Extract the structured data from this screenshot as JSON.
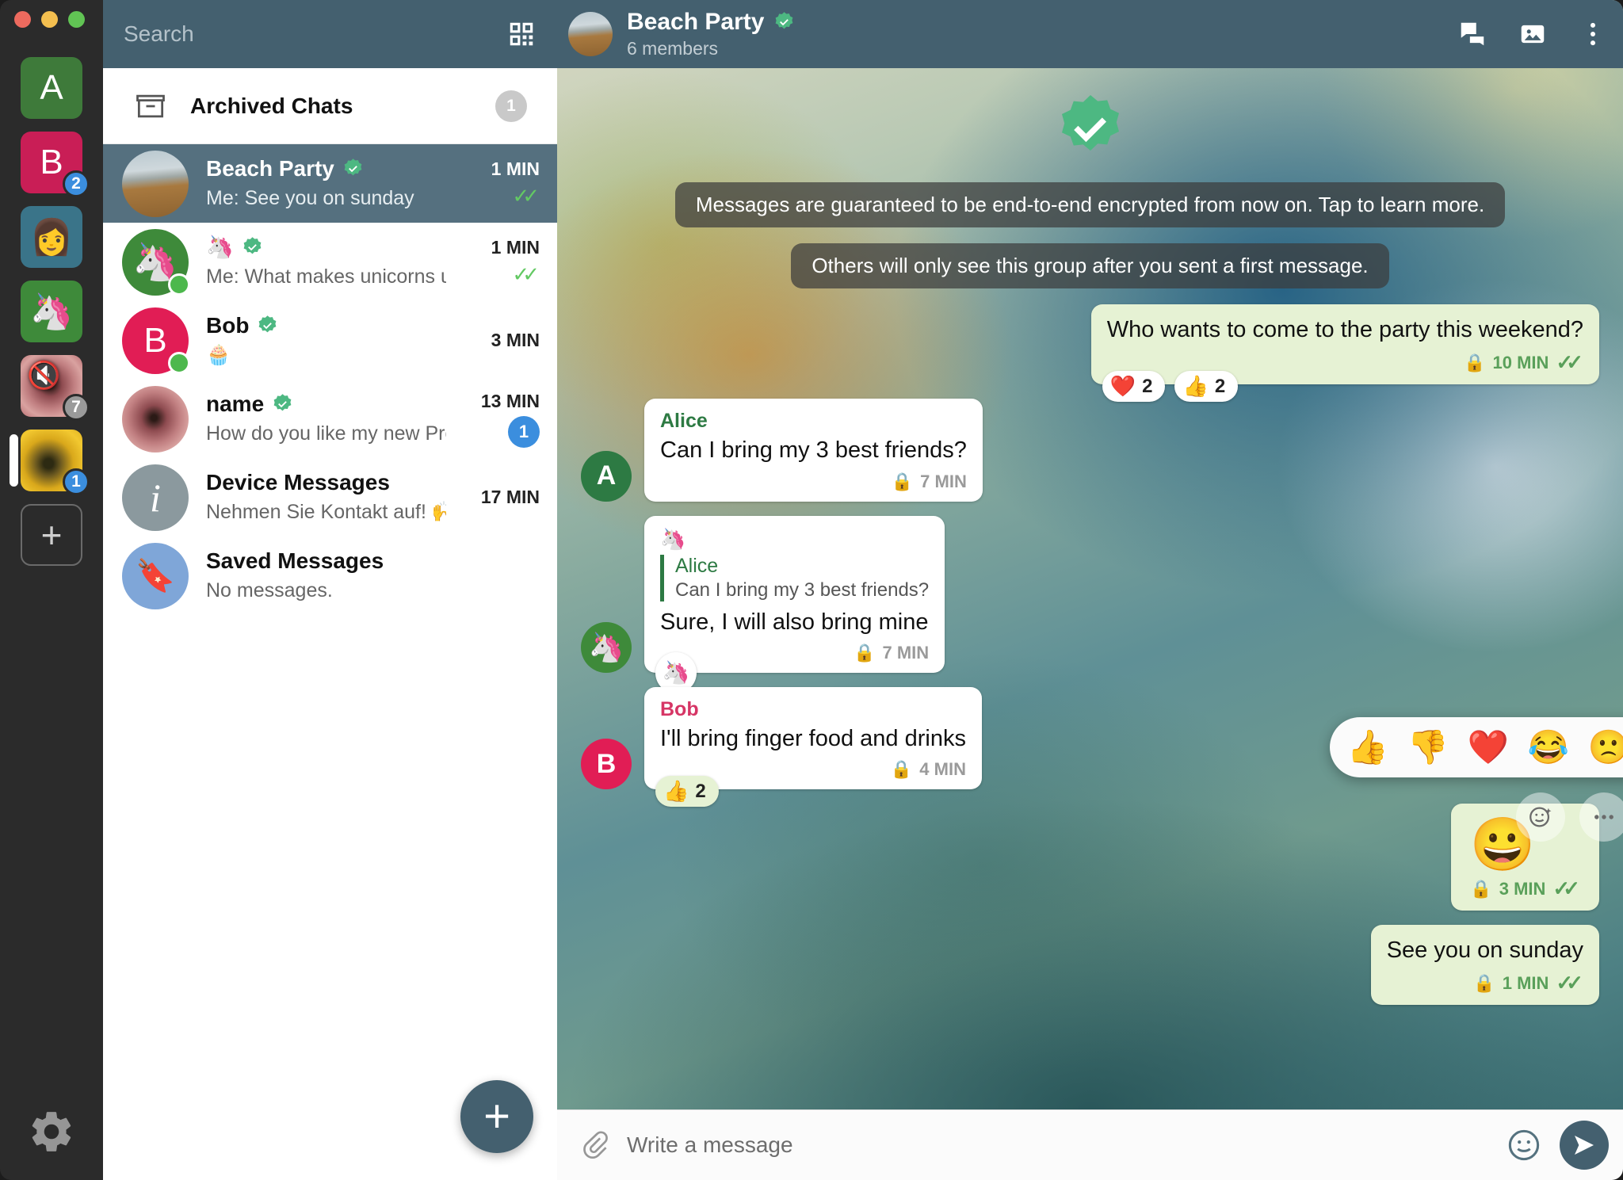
{
  "window": {
    "traffic_lights": [
      "close",
      "minimize",
      "maximize"
    ]
  },
  "rail": {
    "accounts": [
      {
        "label": "A",
        "type": "letter",
        "color": "#3e7a3a",
        "badge": null,
        "muted": false,
        "selected": false
      },
      {
        "label": "B",
        "type": "letter",
        "color": "#c91e56",
        "badge": "2",
        "badge_color": "#3b8ede",
        "muted": false,
        "selected": false
      },
      {
        "label": "👩",
        "type": "emoji",
        "color": "#3a7489",
        "badge": null,
        "muted": false,
        "selected": false
      },
      {
        "label": "🦄",
        "type": "emoji",
        "color": "#3e8a3a",
        "badge": null,
        "muted": false,
        "selected": false
      },
      {
        "label": "",
        "type": "photo-flower",
        "color": "",
        "badge": "7",
        "badge_color": "#9a9a9a",
        "muted": true,
        "selected": false
      },
      {
        "label": "",
        "type": "photo-bee",
        "color": "",
        "badge": "1",
        "badge_color": "#3b8ede",
        "muted": false,
        "selected": true
      }
    ],
    "add_label": "+",
    "settings_icon": "gear-icon"
  },
  "search": {
    "placeholder": "Search",
    "qr_icon": "qr-code-icon"
  },
  "archived": {
    "label": "Archived Chats",
    "count": "1",
    "icon": "archive-box-icon"
  },
  "chats": [
    {
      "name": "Beach Party",
      "verified": true,
      "preview_prefix": "Me:",
      "preview": "See you on sunday",
      "time": "1 MIN",
      "ticks": true,
      "badge": null,
      "avatar_type": "photo-beach",
      "avatar_label": "",
      "avatar_color": "",
      "online": false,
      "active": true
    },
    {
      "name": "🦄",
      "verified": true,
      "preview_prefix": "Me:",
      "preview": "What makes unicorns unique?",
      "time": "1 MIN",
      "ticks": true,
      "badge": null,
      "avatar_type": "emoji",
      "avatar_label": "🦄",
      "avatar_color": "#3e8a3a",
      "online": true,
      "active": false
    },
    {
      "name": "Bob",
      "verified": true,
      "preview_prefix": "",
      "preview": "🧁",
      "time": "3 MIN",
      "ticks": false,
      "badge": null,
      "avatar_type": "letter",
      "avatar_label": "B",
      "avatar_color": "#e11d55",
      "online": true,
      "active": false
    },
    {
      "name": "name",
      "verified": true,
      "preview_prefix": "",
      "preview": "How do you like my new Profile Picture",
      "time": "13 MIN",
      "ticks": false,
      "badge": "1",
      "avatar_type": "photo-flower",
      "avatar_label": "",
      "avatar_color": "",
      "online": false,
      "active": false
    },
    {
      "name": "Device Messages",
      "verified": false,
      "preview_prefix": "",
      "preview": "Nehmen Sie Kontakt auf! 🙌 Tippen Sie a",
      "time": "17 MIN",
      "ticks": false,
      "badge": null,
      "avatar_type": "info",
      "avatar_label": "i",
      "avatar_color": "#8b999e",
      "online": false,
      "active": false
    },
    {
      "name": "Saved Messages",
      "verified": false,
      "preview_prefix": "",
      "preview": "No messages.",
      "time": "",
      "ticks": false,
      "badge": null,
      "avatar_type": "saved",
      "avatar_label": "🔖",
      "avatar_color": "#7fa6d8",
      "online": false,
      "active": false
    }
  ],
  "new_chat_fab": "+",
  "conversation": {
    "title": "Beach Party",
    "verified": true,
    "subtitle": "6 members",
    "header_buttons": [
      {
        "name": "chat-bubbles-icon"
      },
      {
        "name": "gallery-icon"
      },
      {
        "name": "more-vertical-icon"
      }
    ],
    "system_messages": [
      "Messages are guaranteed to be end-to-end encrypted from now on. Tap to learn more.",
      "Others will only see this group after you sent a first message."
    ],
    "messages": [
      {
        "id": "m1",
        "direction": "out",
        "sender": "",
        "sender_color": "",
        "text": "Who wants to come to the party this weekend?",
        "time": "10 MIN",
        "encrypted": true,
        "ticks": true,
        "avatar_label": "",
        "avatar_color": "",
        "reactions": [
          {
            "emoji": "❤️",
            "count": "2"
          },
          {
            "emoji": "👍",
            "count": "2"
          }
        ]
      },
      {
        "id": "m2",
        "direction": "in",
        "sender": "Alice",
        "sender_color": "green",
        "text": "Can I bring my 3 best friends?",
        "time": "7 MIN",
        "encrypted": true,
        "ticks": false,
        "avatar_label": "A",
        "avatar_color": "#2d7a43",
        "reactions": []
      },
      {
        "id": "m3",
        "direction": "in",
        "sender": "Alice",
        "sender_color": "green",
        "forward_emoji": "🦄",
        "quote_name": "Alice",
        "quote_text": "Can I bring my 3 best friends?",
        "text": "Sure, I will also bring mine",
        "time": "7 MIN",
        "encrypted": true,
        "ticks": false,
        "avatar_label": "🦄",
        "avatar_color": "#3e8a3a",
        "sticker": "🦄",
        "reactions": []
      },
      {
        "id": "m4",
        "direction": "in",
        "sender": "Bob",
        "sender_color": "pink",
        "text": "I'll bring finger food and drinks",
        "time": "4 MIN",
        "encrypted": true,
        "ticks": false,
        "avatar_label": "B",
        "avatar_color": "#e11d55",
        "reactions": [
          {
            "emoji": "👍",
            "count": "2"
          }
        ]
      },
      {
        "id": "m5",
        "direction": "out",
        "sender": "",
        "sender_color": "",
        "emoji_only": "😀",
        "text": "",
        "time": "3 MIN",
        "encrypted": true,
        "ticks": true,
        "avatar_label": "",
        "avatar_color": "",
        "reactions": []
      },
      {
        "id": "m6",
        "direction": "out",
        "sender": "",
        "sender_color": "",
        "text": "See you on sunday",
        "time": "1 MIN",
        "encrypted": true,
        "ticks": true,
        "avatar_label": "",
        "avatar_color": "",
        "reactions": []
      }
    ],
    "reaction_picker": {
      "options": [
        "👍",
        "👎",
        "❤️",
        "😂",
        "🙁"
      ],
      "more_label": "•••"
    },
    "hover_actions": [
      {
        "name": "add-reaction-icon",
        "glyph": "☺"
      },
      {
        "name": "message-menu-icon",
        "glyph": "•••"
      }
    ],
    "composer": {
      "attach_icon": "paperclip-icon",
      "placeholder": "Write a message",
      "emoji_icon": "emoji-icon",
      "send_icon": "send-icon"
    }
  },
  "colors": {
    "header": "#44606f",
    "active_row": "#55707f",
    "accent_blue": "#3b8ede",
    "verified_green": "#4db882",
    "out_bubble": "#e6f2d4",
    "in_bubble": "#ffffff"
  }
}
